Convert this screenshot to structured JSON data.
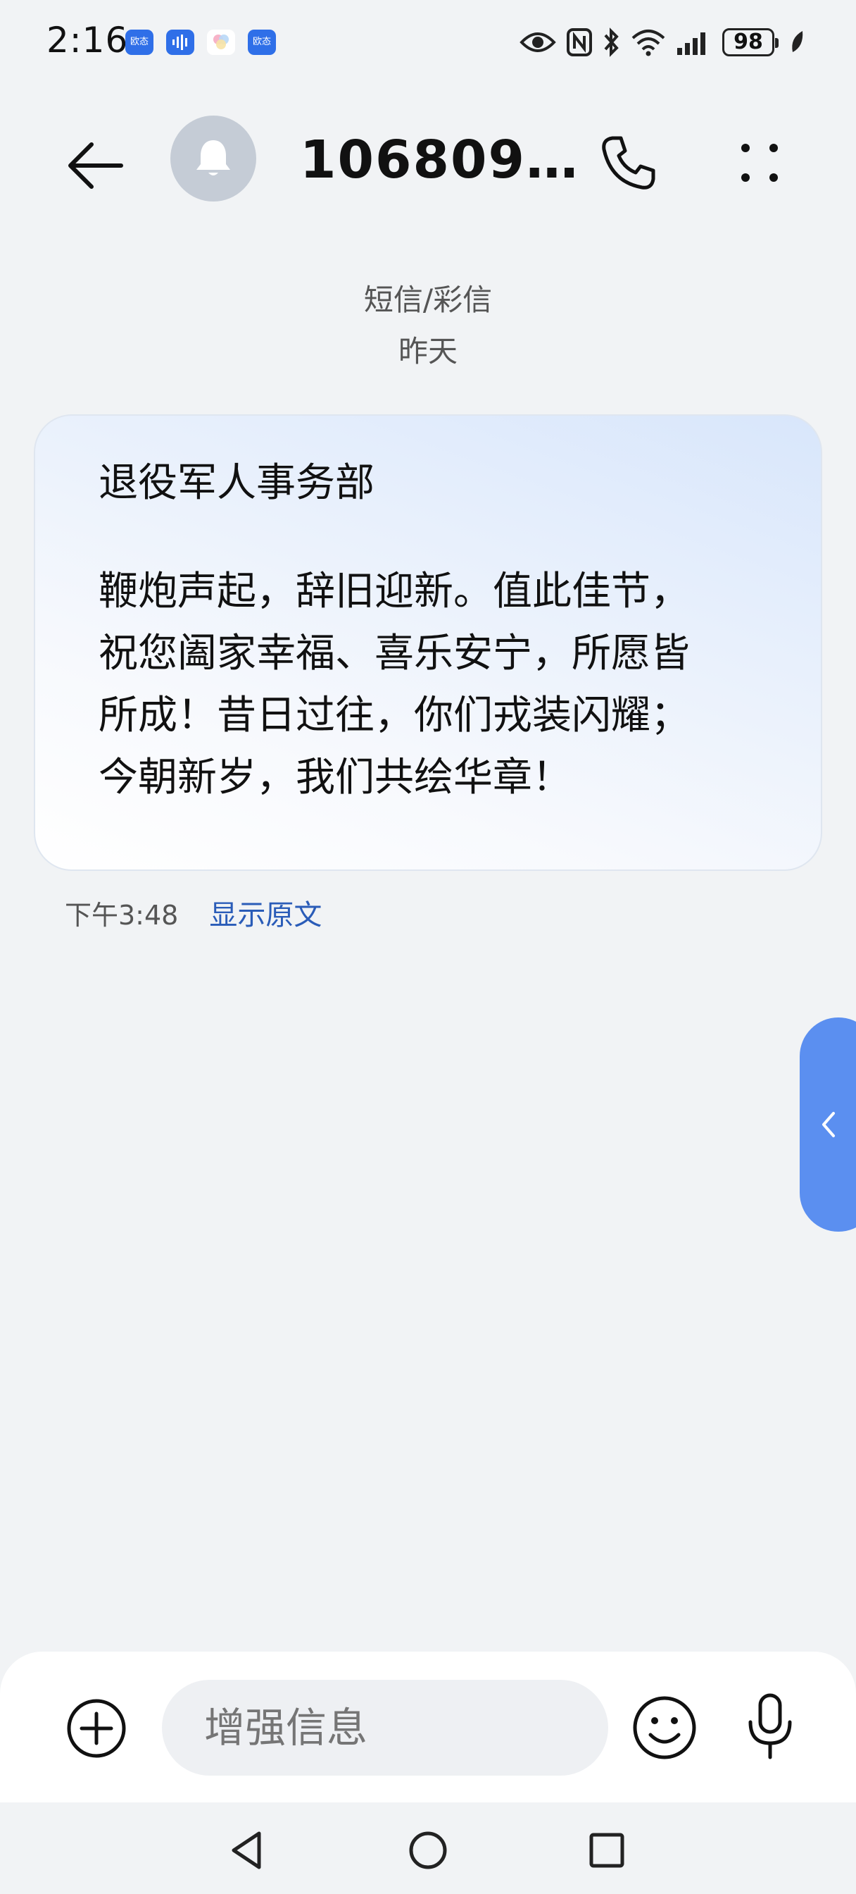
{
  "status_bar": {
    "time": "2:16",
    "apps": [
      {
        "icon": "yitai-app-icon",
        "label": "欧态"
      },
      {
        "icon": "voice-app-icon",
        "label": ""
      },
      {
        "icon": "photos-app-icon",
        "label": ""
      },
      {
        "icon": "yitai-app-icon",
        "label": "欧态"
      }
    ],
    "battery": "98"
  },
  "header": {
    "contact_name": "106809…"
  },
  "conversation": {
    "channel": "短信/彩信",
    "date": "昨天",
    "message": {
      "sender": "退役军人事务部",
      "body": "鞭炮声起，辞旧迎新。值此佳节，\n祝您阖家幸福、喜乐安宁，所愿皆\n所成！昔日过往，你们戎装闪耀；\n今朝新岁，我们共绘华章！",
      "time": "下午3:48",
      "show_original": "显示原文"
    }
  },
  "composer": {
    "placeholder": "增强信息"
  },
  "colors": {
    "accent": "#2a5cb8",
    "side_tab": "#5b8ff0",
    "avatar": "#c5ccd6"
  }
}
